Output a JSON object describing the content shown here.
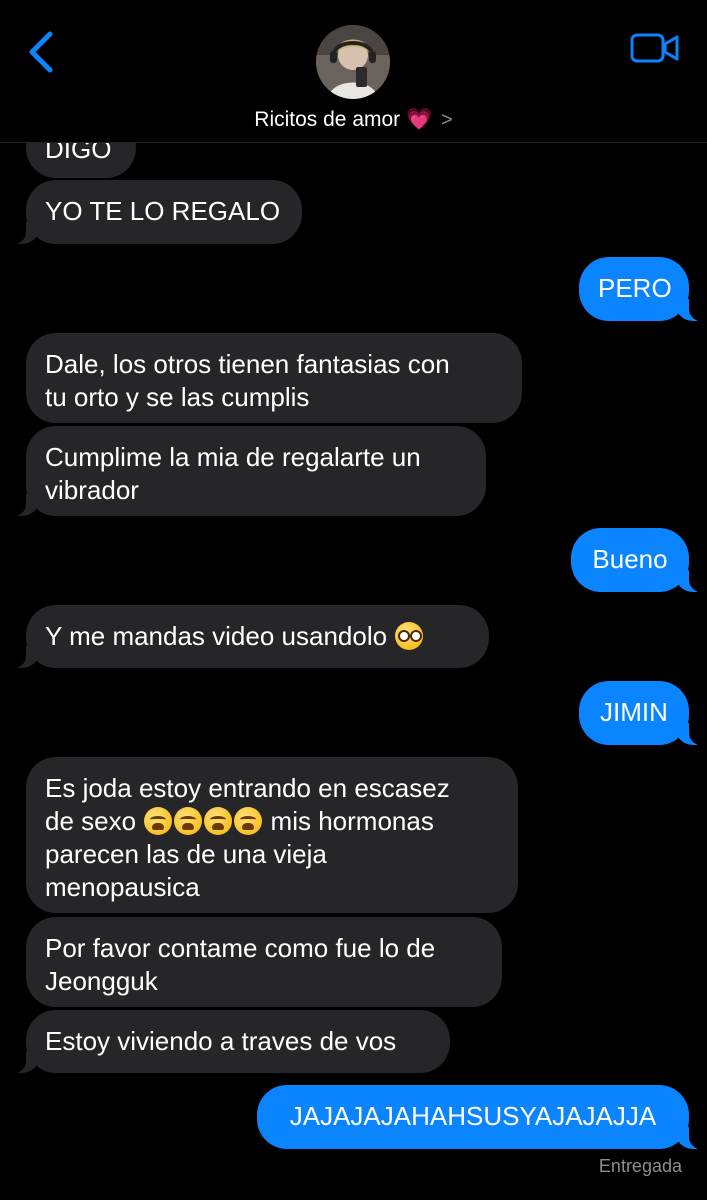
{
  "header": {
    "contact_name": "Ricitos de amor",
    "name_emoji": "💗",
    "chevron": ">",
    "back_icon": "chevron-left-icon",
    "video_icon": "video-camera-icon",
    "accent_color": "#0a84ff"
  },
  "messages": [
    {
      "side": "in",
      "text": "DIGO"
    },
    {
      "side": "in",
      "text": "YO TE LO REGALO"
    },
    {
      "side": "out",
      "text": "PERO"
    },
    {
      "side": "in",
      "line1": "Dale, los otros tienen fantasias con",
      "line2": "tu orto y se las cumplis"
    },
    {
      "side": "in",
      "line1": "Cumplime la mia de regalarte un",
      "line2": "vibrador"
    },
    {
      "side": "out",
      "text": "Bueno"
    },
    {
      "side": "in",
      "text": "Y me mandas video usandolo",
      "emoji": "nerd-face-emoji"
    },
    {
      "side": "out",
      "text": "JIMIN"
    },
    {
      "side": "in",
      "line1": "Es joda estoy entrando en escasez",
      "line2a": "de sexo",
      "emoji": "loudly-crying-face-emoji x4",
      "line2b": "mis hormonas",
      "line3": "parecen las de una vieja",
      "line4": "menopausica"
    },
    {
      "side": "in",
      "line1": "Por favor contame como fue lo de",
      "line2": "Jeongguk"
    },
    {
      "side": "in",
      "text": "Estoy viviendo a traves de vos"
    },
    {
      "side": "out",
      "text": "JAJAJAJAHAHSUSYAJAJAJJA"
    }
  ],
  "delivery_status": "Entregada"
}
